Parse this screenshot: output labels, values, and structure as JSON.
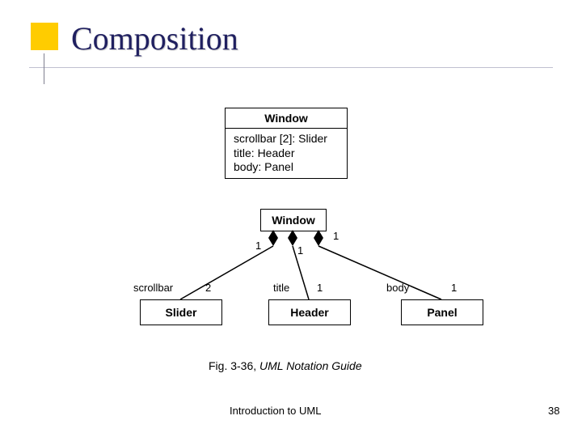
{
  "title": "Composition",
  "classBox": {
    "name": "Window",
    "attrs": "scrollbar [2]: Slider\ntitle: Header\nbody: Panel"
  },
  "diagram": {
    "root": "Window",
    "leaves": {
      "slider": "Slider",
      "header": "Header",
      "panel": "Panel"
    },
    "edges": {
      "scrollbar": {
        "role": "scrollbar",
        "rootMult": "1",
        "leafMult": "2"
      },
      "title": {
        "role": "title",
        "rootMult": "1",
        "leafMult": "1"
      },
      "body": {
        "role": "body",
        "rootMult": "1",
        "leafMult": "1"
      }
    }
  },
  "caption": {
    "prefix": "Fig. 3-36, ",
    "italic": "UML Notation Guide"
  },
  "footer": {
    "center": "Introduction to UML",
    "right": "38"
  }
}
